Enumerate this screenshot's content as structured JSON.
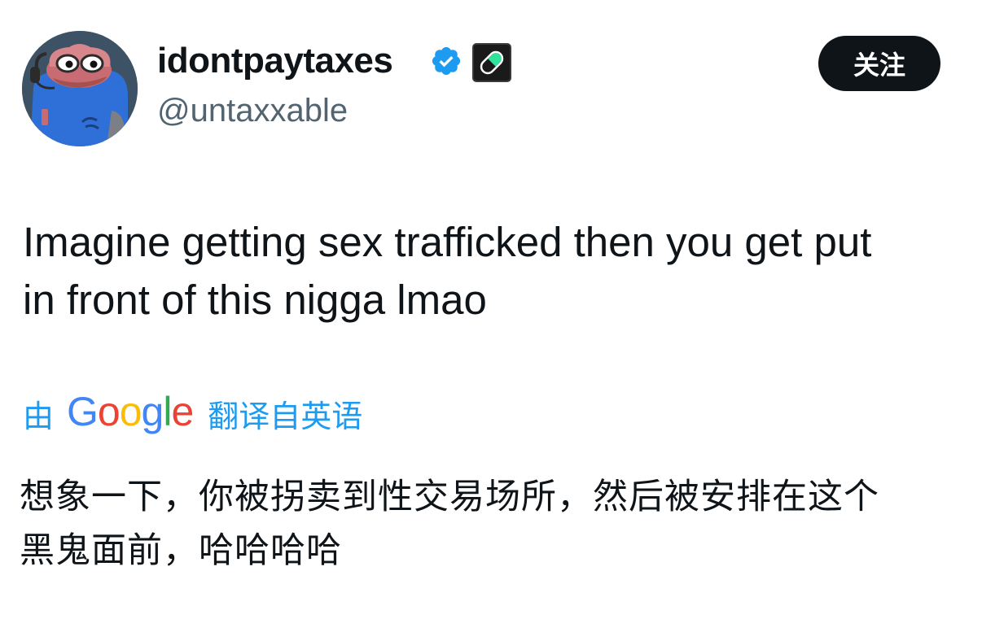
{
  "tweet": {
    "author": {
      "display_name": "idontpaytaxes",
      "handle": "@untaxxable",
      "avatar": "pepe-character-icon",
      "verified_icon": "verified-badge-icon",
      "affiliation_icon": "pill-badge-icon"
    },
    "follow_label": "关注",
    "text_lines": [
      "Imagine getting sex trafficked then you get put",
      "in front of this nigga lmao"
    ],
    "translation": {
      "prefix": "由",
      "provider": "Google",
      "link_label": "翻译自英语"
    },
    "translated_lines": [
      "想象一下，你被拐卖到性交易场所，然后被安排在这个",
      "黑鬼面前，哈哈哈哈"
    ]
  },
  "colors": {
    "accent": "#1d9bf0",
    "text": "#0f1419",
    "secondary_text": "#536471",
    "follow_button_bg": "#0f1419"
  }
}
